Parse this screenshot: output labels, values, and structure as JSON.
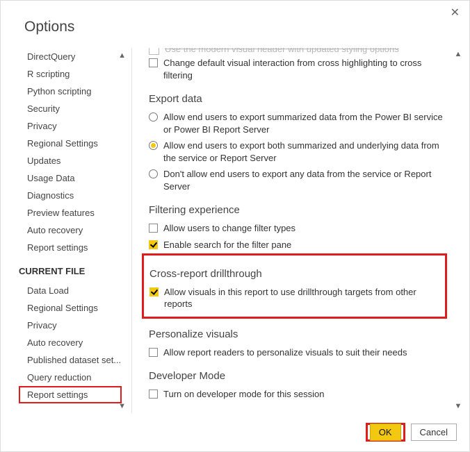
{
  "dialog": {
    "title": "Options"
  },
  "nav": {
    "items_top": [
      "DirectQuery",
      "R scripting",
      "Python scripting",
      "Security",
      "Privacy",
      "Regional Settings",
      "Updates",
      "Usage Data",
      "Diagnostics",
      "Preview features",
      "Auto recovery",
      "Report settings"
    ],
    "header": "CURRENT FILE",
    "items_current": [
      "Data Load",
      "Regional Settings",
      "Privacy",
      "Auto recovery",
      "Published dataset set...",
      "Query reduction",
      "Report settings"
    ]
  },
  "content": {
    "truncated_line": "Use the modern visual header with updated styling options",
    "top_checkbox": {
      "label": "Change default visual interaction from cross highlighting to cross filtering",
      "checked": false
    },
    "sections": [
      {
        "title": "Export data",
        "type": "radio",
        "options": [
          {
            "label": "Allow end users to export summarized data from the Power BI service or Power BI Report Server",
            "checked": false
          },
          {
            "label": "Allow end users to export both summarized and underlying data from the service or Report Server",
            "checked": true
          },
          {
            "label": "Don't allow end users to export any data from the service or Report Server",
            "checked": false
          }
        ]
      },
      {
        "title": "Filtering experience",
        "type": "checkbox",
        "options": [
          {
            "label": "Allow users to change filter types",
            "checked": false
          },
          {
            "label": "Enable search for the filter pane",
            "checked": true
          }
        ]
      },
      {
        "title": "Cross-report drillthrough",
        "type": "checkbox",
        "highlighted": true,
        "options": [
          {
            "label": "Allow visuals in this report to use drillthrough targets from other reports",
            "checked": true
          }
        ]
      },
      {
        "title": "Personalize visuals",
        "type": "checkbox",
        "options": [
          {
            "label": "Allow report readers to personalize visuals to suit their needs",
            "checked": false
          }
        ]
      },
      {
        "title": "Developer Mode",
        "type": "checkbox",
        "options": [
          {
            "label": "Turn on developer mode for this session",
            "checked": false
          }
        ]
      }
    ]
  },
  "footer": {
    "ok": "OK",
    "cancel": "Cancel"
  }
}
